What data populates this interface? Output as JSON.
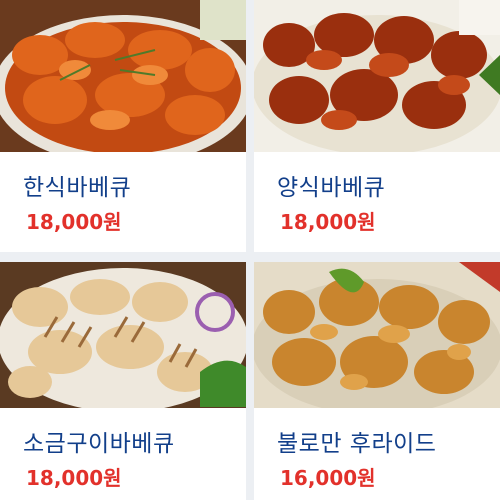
{
  "products": [
    {
      "name": "한식바베큐",
      "price": "18,000원",
      "image": "korean-bbq-chicken-photo"
    },
    {
      "name": "양식바베큐",
      "price": "18,000원",
      "image": "western-bbq-chicken-photo"
    },
    {
      "name": "소금구이바베큐",
      "price": "18,000원",
      "image": "salt-grilled-bbq-chicken-photo"
    },
    {
      "name": "불로만 후라이드",
      "price": "16,000원",
      "image": "fried-chicken-photo"
    }
  ],
  "colors": {
    "product_name": "#123f8a",
    "price": "#e2312b",
    "background": "#eceff3"
  }
}
